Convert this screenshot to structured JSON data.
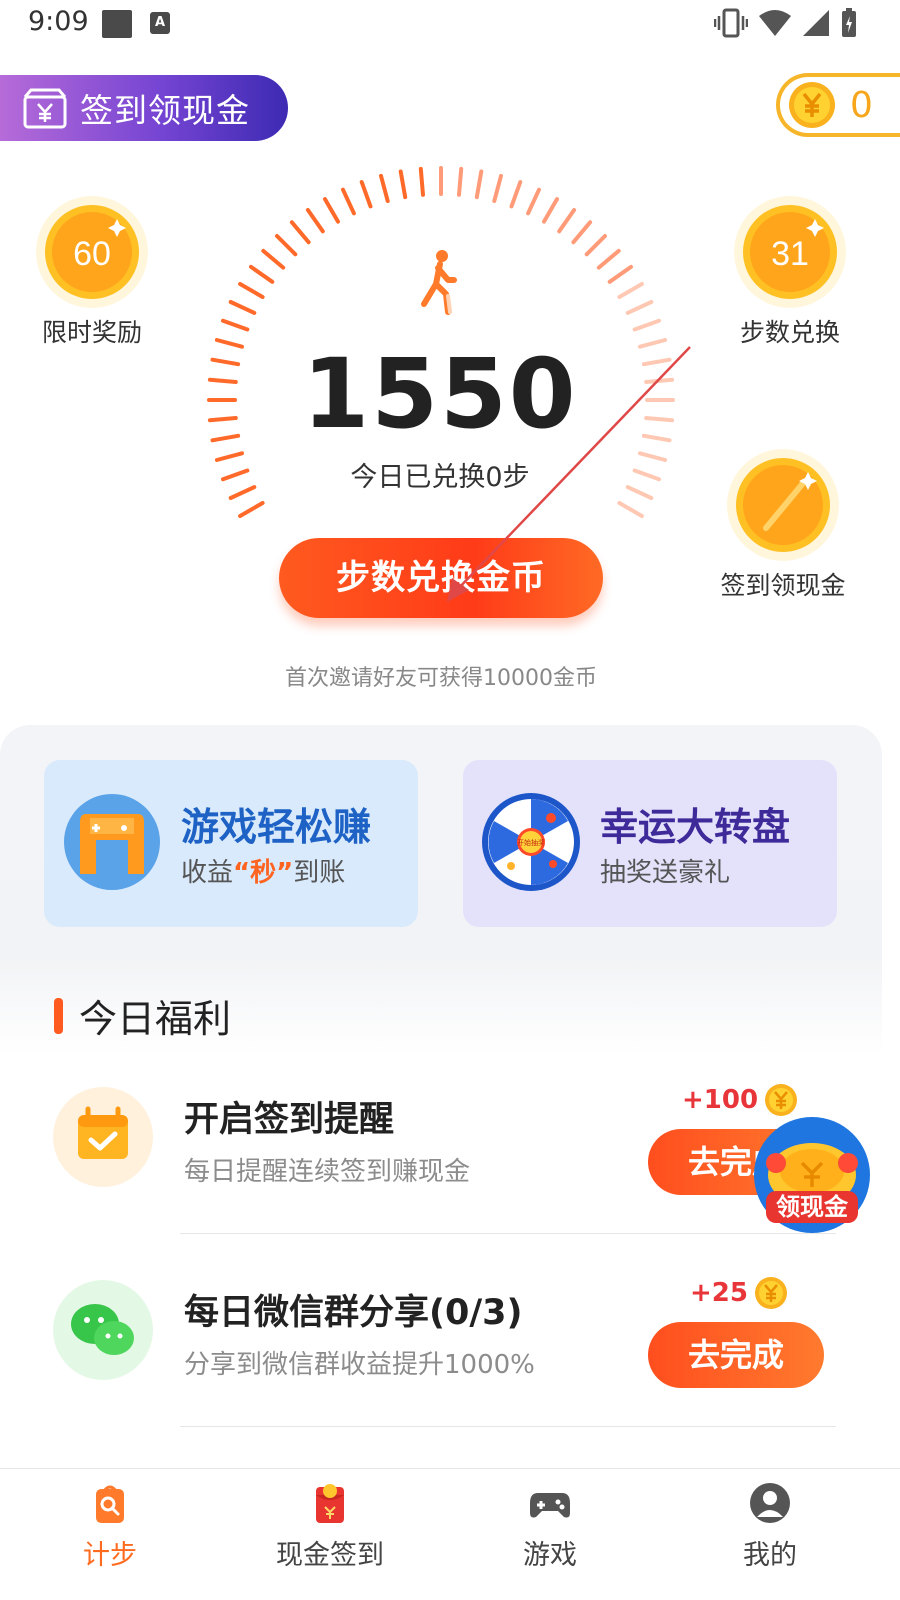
{
  "status_bar": {
    "time": "9:09",
    "badge_letter": "A"
  },
  "top": {
    "signin_label": "签到领现金",
    "coin_balance": "0"
  },
  "left_reward": {
    "value": "60",
    "label": "限时奖励"
  },
  "right_rewards": [
    {
      "value": "31",
      "label": "步数兑换"
    },
    {
      "value": "",
      "label": "签到领现金"
    }
  ],
  "steps": {
    "count": "1550",
    "exchanged_text": "今日已兑换0步"
  },
  "exchange_button": "步数兑换金币",
  "invite_tip": "首次邀请好友可获得10000金币",
  "cards": {
    "game": {
      "title": "游戏轻松赚",
      "sub_prefix": "收益",
      "sub_highlight": "“秒”",
      "sub_suffix": "到账"
    },
    "wheel": {
      "title": "幸运大转盘",
      "sub": "抽奖送豪礼",
      "wheel_center": "开始抽奖"
    }
  },
  "welfare": {
    "title": "今日福利",
    "tasks": [
      {
        "title": "开启签到提醒",
        "desc": "每日提醒连续签到赚现金",
        "reward": "+100",
        "button": "去完成"
      },
      {
        "title": "每日微信群分享(0/3)",
        "desc": "分享到微信群收益提升1000%",
        "reward": "+25",
        "button": "去完成"
      }
    ]
  },
  "float_redpack_label": "领现金",
  "bottom_nav": [
    {
      "label": "计步",
      "icon": "steps-bag-icon",
      "active": true
    },
    {
      "label": "现金签到",
      "icon": "red-envelope-icon",
      "active": false
    },
    {
      "label": "游戏",
      "icon": "gamepad-icon",
      "active": false
    },
    {
      "label": "我的",
      "icon": "profile-icon",
      "active": false
    }
  ],
  "colors": {
    "accent": "#ff5a1f",
    "coin": "#f7b52a",
    "active_tab": "#ff6b1e",
    "reward_red": "#e8353a"
  }
}
